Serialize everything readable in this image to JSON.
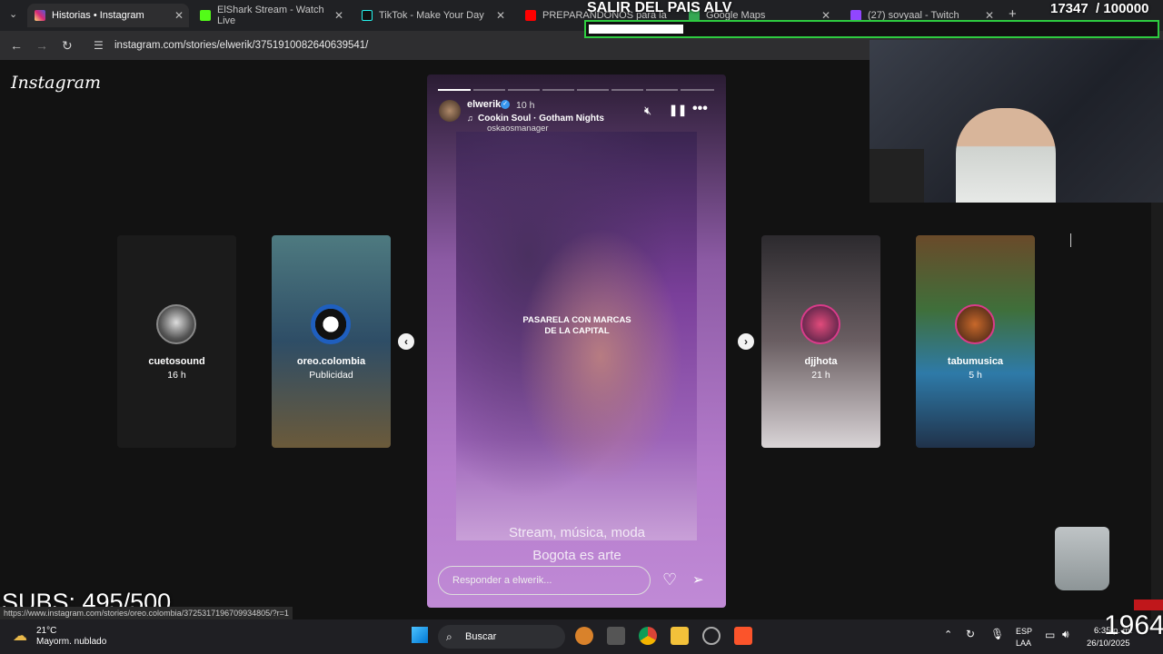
{
  "browser": {
    "tabs": [
      {
        "title": "Historias • Instagram",
        "active": true,
        "color": "#d6249f"
      },
      {
        "title": "ElShark Stream - Watch Live",
        "color": "#53fc18"
      },
      {
        "title": "TikTok - Make Your Day",
        "color": "#111111"
      },
      {
        "title": "PREPARANDONOS para la",
        "color": "#ff0000"
      },
      {
        "title": "Google Maps",
        "color": "#34a853"
      },
      {
        "title": "(27) sovyaal - Twitch",
        "color": "#9146ff"
      }
    ],
    "url": "instagram.com/stories/elwerik/3751910082640639541/",
    "status_url": "https://www.instagram.com/stories/oreo.colombia/3725317196709934805/?r=1"
  },
  "instagram": {
    "logo": "Instagram",
    "side_stories": [
      {
        "name": "cuetosound",
        "meta": "16 h",
        "bg": "#1c1c1c"
      },
      {
        "name": "oreo.colombia",
        "meta": "Publicidad",
        "bg": "#3b5a6e"
      },
      {
        "name": "djjhota",
        "meta": "21 h",
        "bg": "#e8e4e6"
      },
      {
        "name": "tabumusica",
        "meta": "5 h",
        "bg": "#5a7d4a"
      }
    ],
    "story": {
      "username": "elwerik",
      "time": "10 h",
      "music": "Cookin Soul · Gotham Nights",
      "mention": "oskaosmanager",
      "sticker_line1": "PASARELA CON MARCAS",
      "sticker_line2": "DE LA CAPITAL",
      "caption_line1": "Stream, música, moda",
      "caption_line2": "Bogota es arte",
      "reply_placeholder": "Responder a elwerik..."
    }
  },
  "overlay": {
    "title": "SALIR DEL PAIS ALV",
    "counter": "17347  / 100000",
    "subs": "SUBS: 495/500",
    "bottom_number": "1964"
  },
  "taskbar": {
    "weather_temp": "21°C",
    "weather_desc": "Mayorm. nublado",
    "search": "Buscar",
    "lang_top": "ESP",
    "lang_bottom": "LAA",
    "time": "6:35 p. m.",
    "date": "26/10/2025"
  }
}
